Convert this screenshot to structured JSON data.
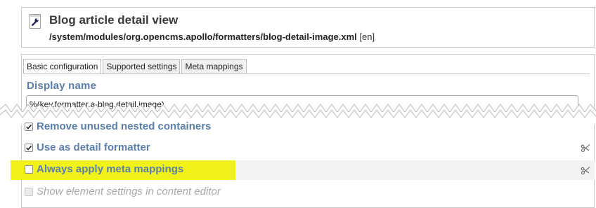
{
  "header": {
    "icon": "wrench-icon",
    "title": "Blog article detail view",
    "path": "/system/modules/org.opencms.apollo/formatters/blog-detail-image.xml",
    "locale": "[en]"
  },
  "tabs": [
    {
      "label": "Basic configuration",
      "active": true
    },
    {
      "label": "Supported settings",
      "active": false
    },
    {
      "label": "Meta mappings",
      "active": false
    }
  ],
  "display_name": {
    "label": "Display name",
    "value": "%(key.formatter.a-blog.detail.image)"
  },
  "options": [
    {
      "label": "Remove unused nested containers",
      "checked": true,
      "enabled": true
    },
    {
      "label": "Use as detail formatter",
      "checked": true,
      "enabled": true
    },
    {
      "label": "Always apply meta mappings",
      "checked": false,
      "enabled": true
    },
    {
      "label": "Show element settings in content editor",
      "checked": false,
      "enabled": false
    }
  ],
  "colors": {
    "label_blue": "#5b7fa8",
    "highlight_yellow": "#f0f21a"
  }
}
